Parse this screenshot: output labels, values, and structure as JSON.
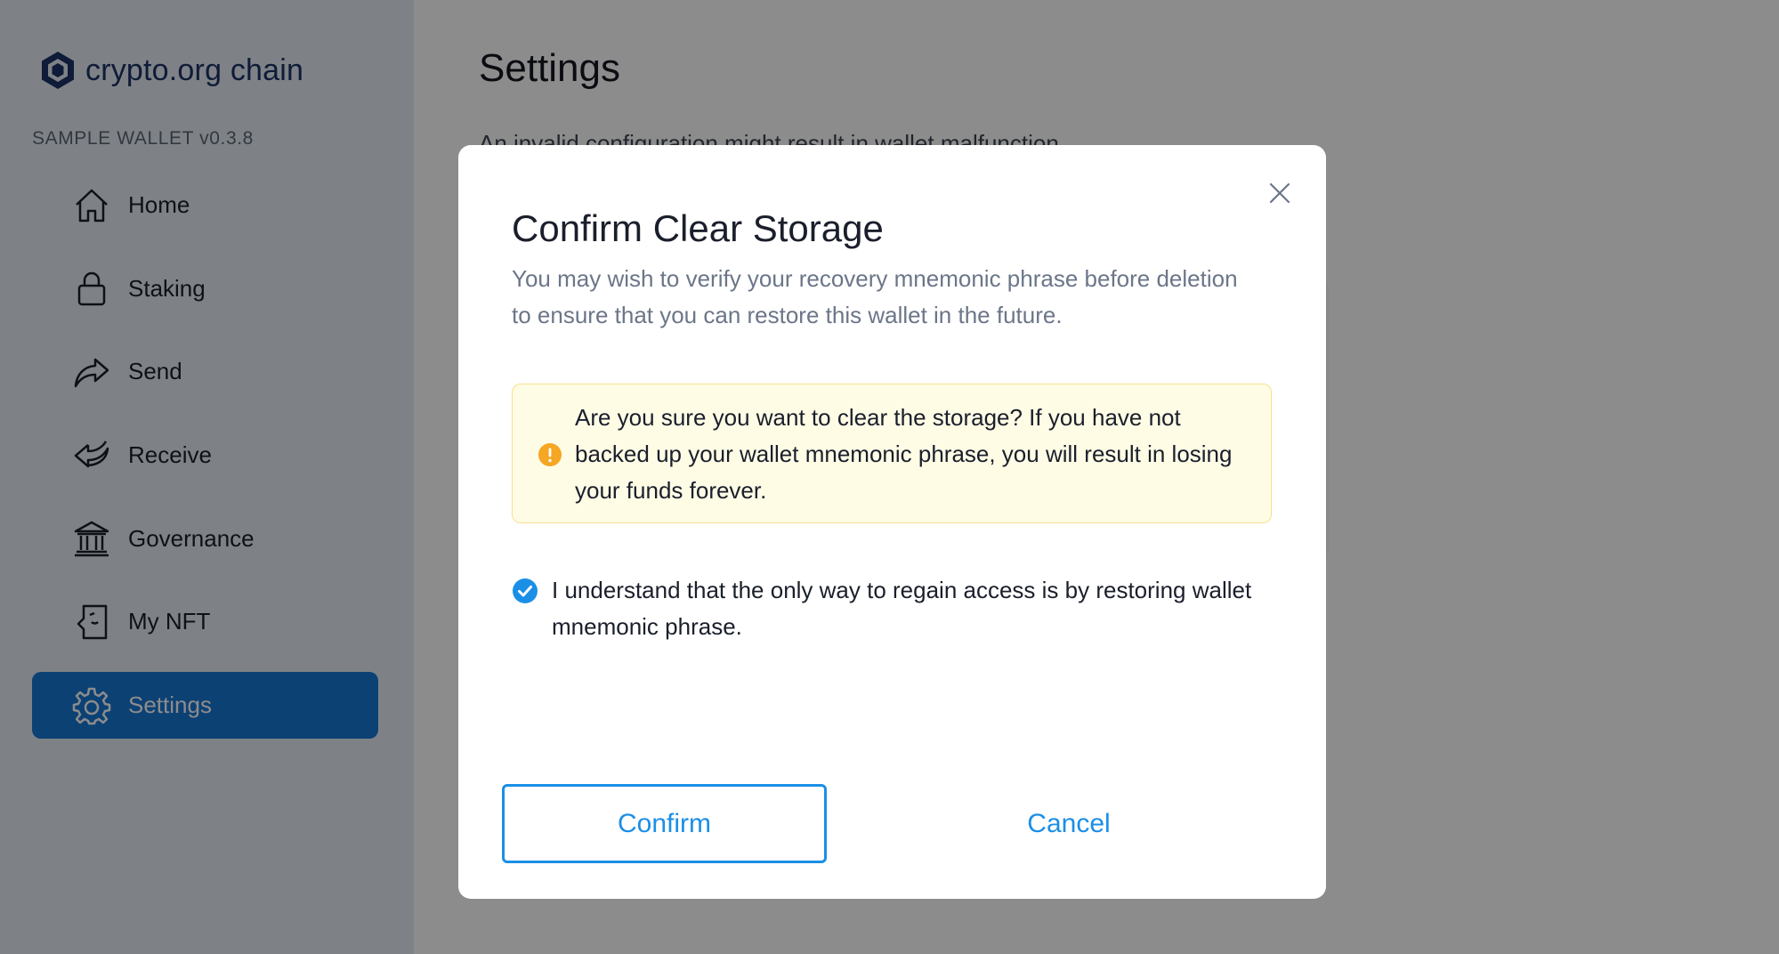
{
  "sidebar": {
    "logo_text": "crypto.org chain",
    "version": "SAMPLE WALLET v0.3.8",
    "items": [
      {
        "label": "Home",
        "icon": "home-icon"
      },
      {
        "label": "Staking",
        "icon": "lock-icon"
      },
      {
        "label": "Send",
        "icon": "send-arrow-icon"
      },
      {
        "label": "Receive",
        "icon": "receive-arrow-icon"
      },
      {
        "label": "Governance",
        "icon": "bank-icon"
      },
      {
        "label": "My NFT",
        "icon": "nft-icon"
      },
      {
        "label": "Settings",
        "icon": "gear-icon",
        "active": true
      }
    ]
  },
  "main": {
    "title": "Settings",
    "subtitle": "An invalid configuration might result in wallet malfunction.",
    "card_peek": "y"
  },
  "modal": {
    "title": "Confirm Clear Storage",
    "description": "You may wish to verify your recovery mnemonic phrase before deletion to ensure that you can restore this wallet in the future.",
    "warning_text": "Are you sure you want to clear the storage? If you have not backed up your wallet mnemonic phrase, you will result in losing your funds forever.",
    "acknowledge_text": "I understand that the only way to regain access is by restoring wallet mnemonic phrase.",
    "acknowledge_checked": true,
    "confirm_label": "Confirm",
    "cancel_label": "Cancel"
  },
  "colors": {
    "accent": "#1b8fe6",
    "sidebar_active": "#1777d4",
    "warning_bg": "#fffce6",
    "warning_border": "#f7e08a",
    "warning_icon": "#f5a623",
    "brand": "#1d3266"
  }
}
